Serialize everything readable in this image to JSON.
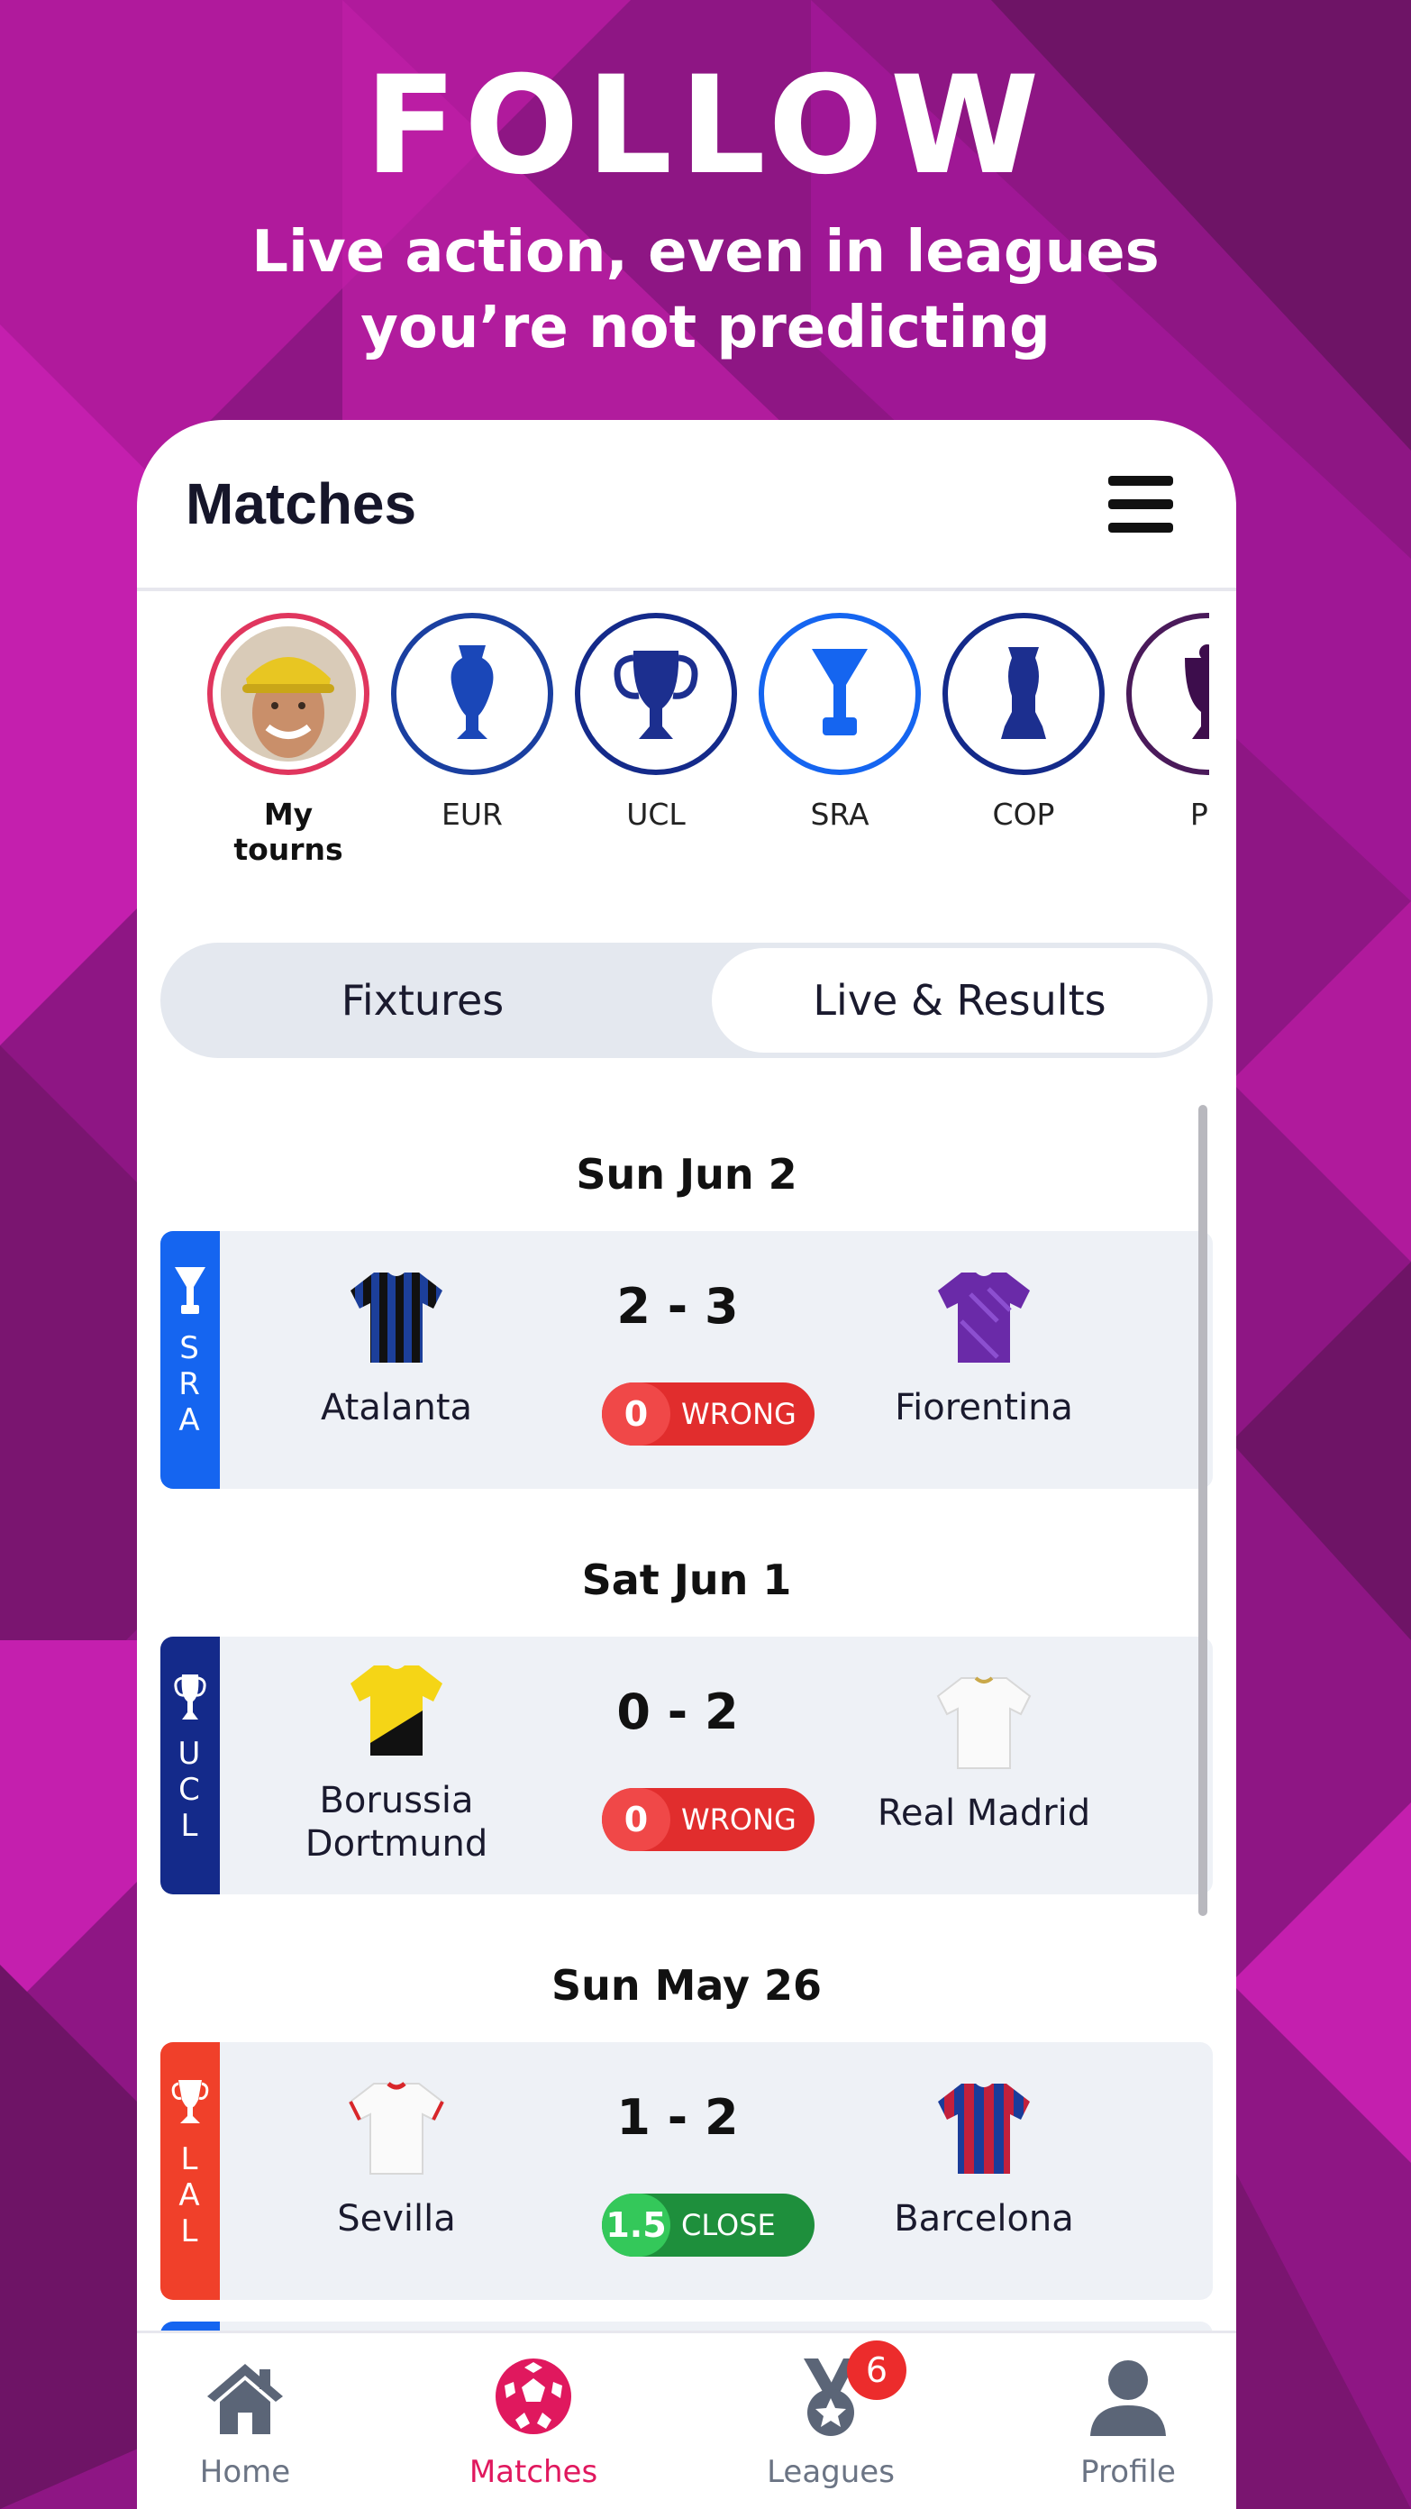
{
  "hero": {
    "title": "FOLLOW",
    "subtitle_line1": "Live action, even in leagues",
    "subtitle_line2": "you’re not predicting"
  },
  "appbar": {
    "title": "Matches",
    "menu_icon": "hamburger-menu-icon"
  },
  "tournaments": [
    {
      "label": "My tourns",
      "icon": "user-avatar",
      "active": true
    },
    {
      "label": "EUR",
      "icon": "euro-trophy-icon"
    },
    {
      "label": "UCL",
      "icon": "champions-league-trophy-icon"
    },
    {
      "label": "SRA",
      "icon": "serie-a-trophy-icon"
    },
    {
      "label": "COP",
      "icon": "copa-america-trophy-icon"
    },
    {
      "label": "PL",
      "icon": "premier-league-trophy-icon"
    }
  ],
  "segments": {
    "left": "Fixtures",
    "right": "Live & Results",
    "selected": "right"
  },
  "matches": [
    {
      "date": "Sun Jun 2",
      "league": "SRA",
      "league_letters": [
        "S",
        "R",
        "A"
      ],
      "league_color": "#1565f0",
      "home": {
        "name": "Atalanta",
        "shirt": "black-blue-stripes"
      },
      "away": {
        "name": "Fiorentina",
        "shirt": "purple"
      },
      "score": "2 - 3",
      "points": "0",
      "result": "WRONG"
    },
    {
      "date": "Sat Jun 1",
      "league": "UCL",
      "league_letters": [
        "U",
        "C",
        "L"
      ],
      "league_color": "#142a8a",
      "home": {
        "name_line1": "Borussia",
        "name_line2": "Dortmund",
        "shirt": "yellow-black"
      },
      "away": {
        "name": "Real Madrid",
        "shirt": "white"
      },
      "score": "0 - 2",
      "points": "0",
      "result": "WRONG"
    },
    {
      "date": "Sun May 26",
      "league": "LAL",
      "league_letters": [
        "L",
        "A",
        "L"
      ],
      "league_color": "#f0402a",
      "home": {
        "name": "Sevilla",
        "shirt": "white-red-trim"
      },
      "away": {
        "name": "Barcelona",
        "shirt": "blue-red-stripes"
      },
      "score": "1 - 2",
      "points": "1.5",
      "result": "CLOSE"
    }
  ],
  "bottom_nav": [
    {
      "label": "Home",
      "icon": "home-icon"
    },
    {
      "label": "Matches",
      "icon": "soccer-ball-icon",
      "active": true
    },
    {
      "label": "Leagues",
      "icon": "medal-icon",
      "badge": "6"
    },
    {
      "label": "Profile",
      "icon": "profile-icon"
    }
  ],
  "colors": {
    "accent": "#e0185e",
    "wrong": "#e12d2d",
    "close": "#1e8f3c",
    "background": "#9a1a8c"
  }
}
